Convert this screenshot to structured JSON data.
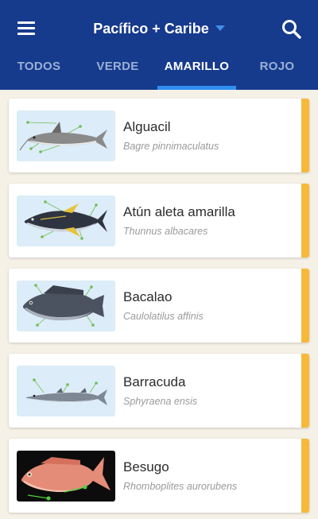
{
  "header": {
    "title": "Pacífico + Caribe",
    "menu_icon": "hamburger-menu-icon",
    "search_icon": "search-icon",
    "caret_color": "#3f8fe8",
    "background": "#163a8c"
  },
  "tabs": [
    {
      "label": "TODOS",
      "active": false
    },
    {
      "label": "VERDE",
      "active": false
    },
    {
      "label": "AMARILLO",
      "active": true
    },
    {
      "label": "ROJO",
      "active": false
    }
  ],
  "species": [
    {
      "name": "Alguacil",
      "scientific": "Bagre pinnimaculatus",
      "status_color": "#f6b93a"
    },
    {
      "name": "Atún aleta amarilla",
      "scientific": "Thunnus albacares",
      "status_color": "#f6b93a"
    },
    {
      "name": "Bacalao",
      "scientific": "Caulolatilus affinis",
      "status_color": "#f6b93a"
    },
    {
      "name": "Barracuda",
      "scientific": "Sphyraena ensis",
      "status_color": "#f6b93a"
    },
    {
      "name": "Besugo",
      "scientific": "Rhomboplites aurorubens",
      "status_color": "#f6b93a"
    }
  ]
}
